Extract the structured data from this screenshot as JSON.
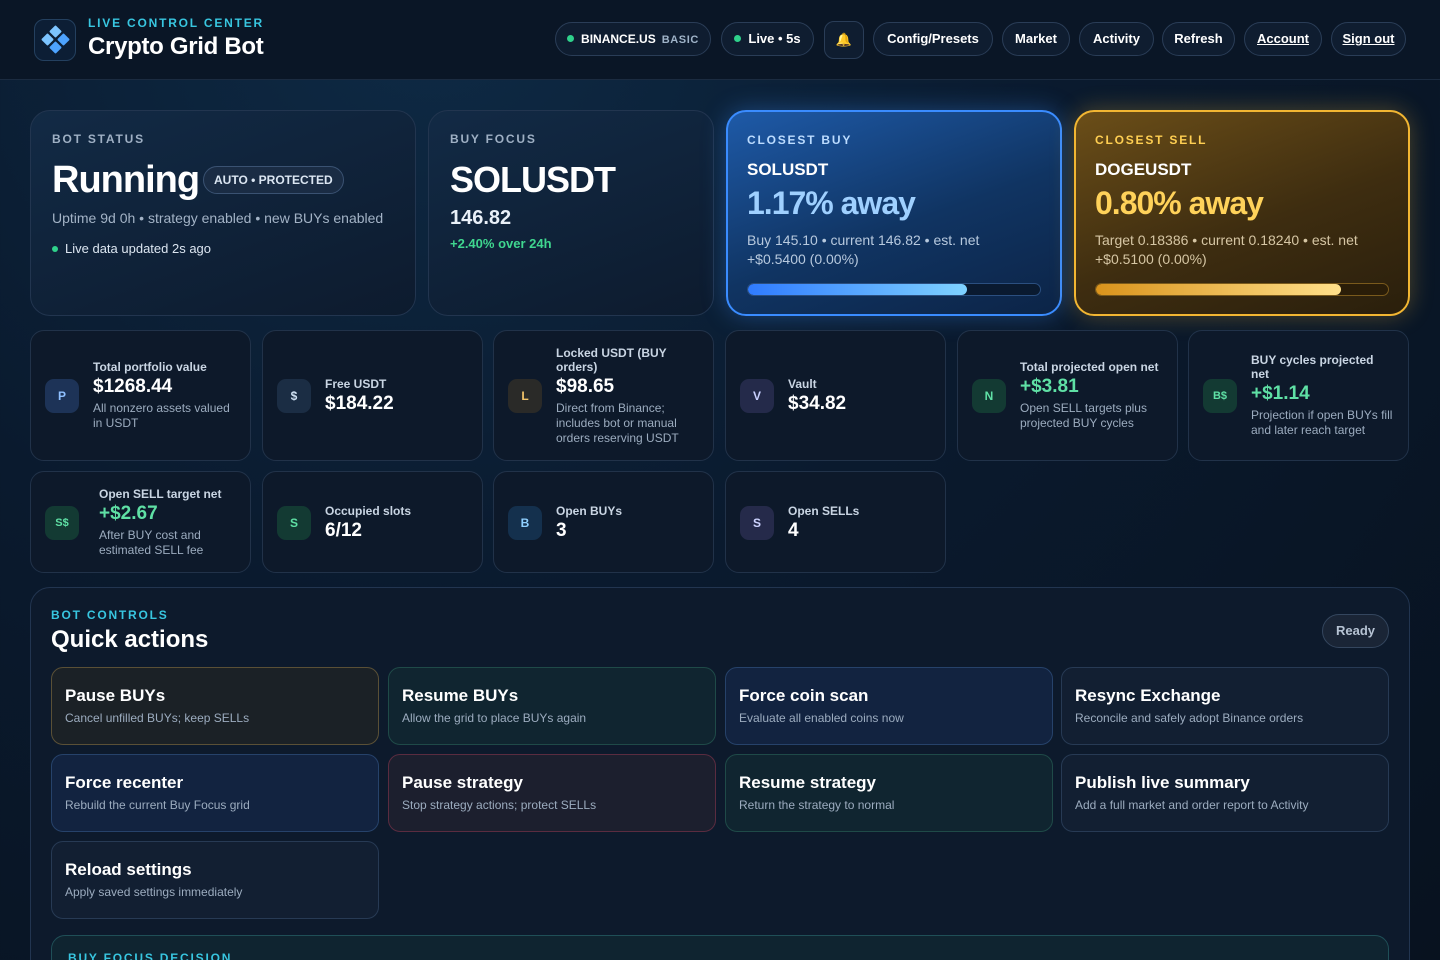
{
  "header": {
    "kicker": "LIVE CONTROL CENTER",
    "title": "Crypto Grid Bot",
    "exchange": "BINANCE.US",
    "plan": "BASIC",
    "live": "Live • 5s",
    "bell": "🔔",
    "nav": [
      "Config/Presets",
      "Market",
      "Activity",
      "Refresh",
      "Account",
      "Sign out"
    ]
  },
  "bot_status": {
    "kicker": "BOT STATUS",
    "state": "Running",
    "badge": "AUTO • PROTECTED",
    "details": "Uptime 9d 0h • strategy enabled • new BUYs enabled",
    "live_note": "Live data updated 2s ago"
  },
  "buy_focus": {
    "kicker": "BUY FOCUS",
    "symbol": "SOLUSDT",
    "price": "146.82",
    "change": "+2.40% over 24h"
  },
  "closest_buy": {
    "kicker": "CLOSEST BUY",
    "symbol": "SOLUSDT",
    "distance": "1.17% away",
    "line1": "Buy 145.10 • current 146.82 • est. net",
    "line2": "+$0.5400 (0.00%)",
    "progress": 0.75
  },
  "closest_sell": {
    "kicker": "CLOSEST SELL",
    "symbol": "DOGEUSDT",
    "distance": "0.80% away",
    "line1": "Target 0.18386 • current 0.18240 • est. net",
    "line2": "+$0.5100 (0.00%)",
    "progress": 0.84
  },
  "stats": [
    {
      "icon": "P",
      "label": "Total portfolio value",
      "value": "$1268.44",
      "sub": "All nonzero assets valued in USDT"
    },
    {
      "icon": "$",
      "label": "Free USDT",
      "value": "$184.22",
      "sub": ""
    },
    {
      "icon": "L",
      "label": "Locked USDT (BUY orders)",
      "value": "$98.65",
      "sub": "Direct from Binance; includes bot or manual orders reserving USDT"
    },
    {
      "icon": "V",
      "label": "Vault",
      "value": "$34.82",
      "sub": ""
    },
    {
      "icon": "N",
      "label": "Total projected open net",
      "value": "+$3.81",
      "sub": "Open SELL targets plus projected BUY cycles"
    },
    {
      "icon": "B$",
      "label": "BUY cycles projected net",
      "value": "+$1.14",
      "sub": "Projection if open BUYs fill and later reach target"
    },
    {
      "icon": "S$",
      "label": "Open SELL target net",
      "value": "+$2.67",
      "sub": "After BUY cost and estimated SELL fee"
    },
    {
      "icon": "S",
      "label": "Occupied slots",
      "value": "6/12",
      "sub": ""
    },
    {
      "icon": "B",
      "label": "Open BUYs",
      "value": "3",
      "sub": ""
    },
    {
      "icon": "S",
      "label": "Open SELLs",
      "value": "4",
      "sub": ""
    }
  ],
  "controls": {
    "kicker": "BOT CONTROLS",
    "title": "Quick actions",
    "ready": "Ready",
    "actions": [
      {
        "title": "Pause BUYs",
        "desc": "Cancel unfilled BUYs; keep SELLs"
      },
      {
        "title": "Resume BUYs",
        "desc": "Allow the grid to place BUYs again"
      },
      {
        "title": "Force coin scan",
        "desc": "Evaluate all enabled coins now"
      },
      {
        "title": "Resync Exchange",
        "desc": "Reconcile and safely adopt Binance orders"
      },
      {
        "title": "Force recenter",
        "desc": "Rebuild the current Buy Focus grid"
      },
      {
        "title": "Pause strategy",
        "desc": "Stop strategy actions; protect SELLs"
      },
      {
        "title": "Resume strategy",
        "desc": "Return the strategy to normal"
      },
      {
        "title": "Publish live summary",
        "desc": "Add a full market and order report to Activity"
      },
      {
        "title": "Reload settings",
        "desc": "Apply saved settings immediately"
      }
    ],
    "next_kicker": "BUY FOCUS DECISION"
  },
  "colors": {
    "accent_cyan": "#38c6e0",
    "positive": "#3fd68f",
    "buy_blue": "#3b8fff",
    "sell_gold": "#f2b632"
  }
}
